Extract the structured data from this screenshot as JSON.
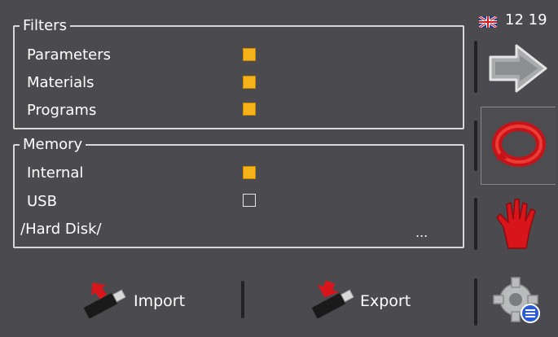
{
  "status": {
    "time": "12 19",
    "flag_icon": "uk-flag-icon"
  },
  "filters": {
    "title": "Filters",
    "items": [
      {
        "label": "Parameters",
        "checked": true
      },
      {
        "label": "Materials",
        "checked": true
      },
      {
        "label": "Programs",
        "checked": true
      }
    ]
  },
  "memory": {
    "title": "Memory",
    "items": [
      {
        "label": "Internal",
        "checked": true
      },
      {
        "label": "USB",
        "checked": false
      }
    ],
    "path": "/Hard Disk/",
    "browse_label": "..."
  },
  "bottom": {
    "import_label": "Import",
    "export_label": "Export"
  },
  "sidebar": {
    "buttons": [
      {
        "icon": "forward-arrow-icon"
      },
      {
        "icon": "reset-circle-icon"
      },
      {
        "icon": "stop-hand-icon"
      },
      {
        "icon": "settings-gear-icon"
      }
    ]
  },
  "colors": {
    "background": "#4b4a4f",
    "checkbox_on": "#f6b21a",
    "accent_red": "#d8151b"
  }
}
